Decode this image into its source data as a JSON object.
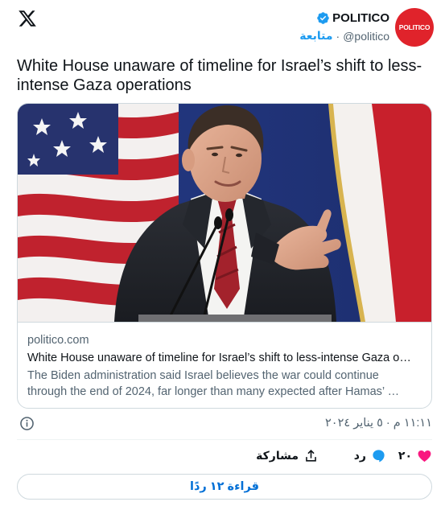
{
  "header": {
    "author_name": "POLITICO",
    "handle": "@politico",
    "separator": "·",
    "follow_label": "متابعة",
    "avatar_text": "POLITICO"
  },
  "tweet": {
    "text": "White House unaware of timeline for Israel’s shift to less-intense Gaza operations"
  },
  "link_card": {
    "domain": "politico.com",
    "title": "White House unaware of timeline for Israel’s shift to less-intense Gaza o…",
    "description_line1": "The Biden administration said Israel believes the war could continue",
    "description_line2": "through the end of 2024, far longer than many expected after Hamas’ …"
  },
  "timestamp": "١١:١١ م · ٥ يناير ٢٠٢٤",
  "actions": {
    "like_count": "٢٠",
    "reply_label": "رد",
    "share_label": "مشاركة"
  },
  "read_replies_label": "قراءة ١٢ ردًا",
  "colors": {
    "accent": "#1d9bf0",
    "like": "#f91880",
    "brand_red": "#e0232b",
    "button_text": "#006fd6"
  },
  "icons": [
    "x-logo-icon",
    "verified-badge-icon",
    "info-icon",
    "heart-icon",
    "reply-bubble-icon",
    "share-icon"
  ]
}
